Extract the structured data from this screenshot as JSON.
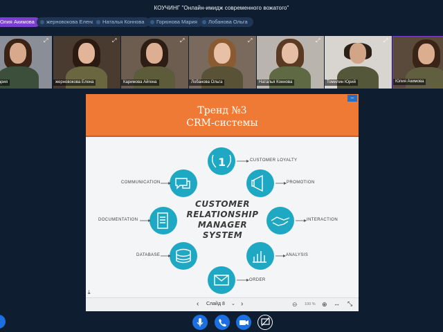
{
  "meeting_title": "КОУЧИНГ \"Онлайн-имидж современного вожатого\"",
  "participant_pills": [
    {
      "label": "Юлия Акимова",
      "active": true
    },
    {
      "label": "жерновокова Елена",
      "active": false
    },
    {
      "label": "Наталья Коннова",
      "active": false
    },
    {
      "label": "Горюнова Мария",
      "active": false
    },
    {
      "label": "Лобанова Ольга",
      "active": false
    }
  ],
  "video_tiles": [
    {
      "name": "ина Мария"
    },
    {
      "name": "жерновокова Елена"
    },
    {
      "name": "Каримова Айгена"
    },
    {
      "name": "Лобанова Ольга"
    },
    {
      "name": "Наталья Коннова"
    },
    {
      "name": "Томилин Юрий"
    },
    {
      "name": "Юлия Акимова"
    }
  ],
  "slide": {
    "title_line1": "Тренд №3",
    "title_line2": "CRM-системы",
    "center_text": [
      "CUSTOMER",
      "RELATIONSHIP",
      "MANAGER",
      "SYSTEM"
    ],
    "nodes": {
      "loyalty": "CUSTOMER LOYALTY",
      "promotion": "PROMOTION",
      "interaction": "INTERACTION",
      "analysis": "ANALYSIS",
      "order": "ORDER",
      "database": "DATABASE",
      "documentation": "DOCUMENTATION",
      "communication": "COMMUNICATION"
    },
    "loyalty_badge": "1",
    "accent_color": "#1fa8c4"
  },
  "slidebar": {
    "slide_label": "Слайд 8",
    "zoom_value": "100 %"
  },
  "controls": {
    "mic": "microphone-icon",
    "call": "phone-icon",
    "camera": "camera-icon",
    "share": "screen-share-off-icon"
  }
}
